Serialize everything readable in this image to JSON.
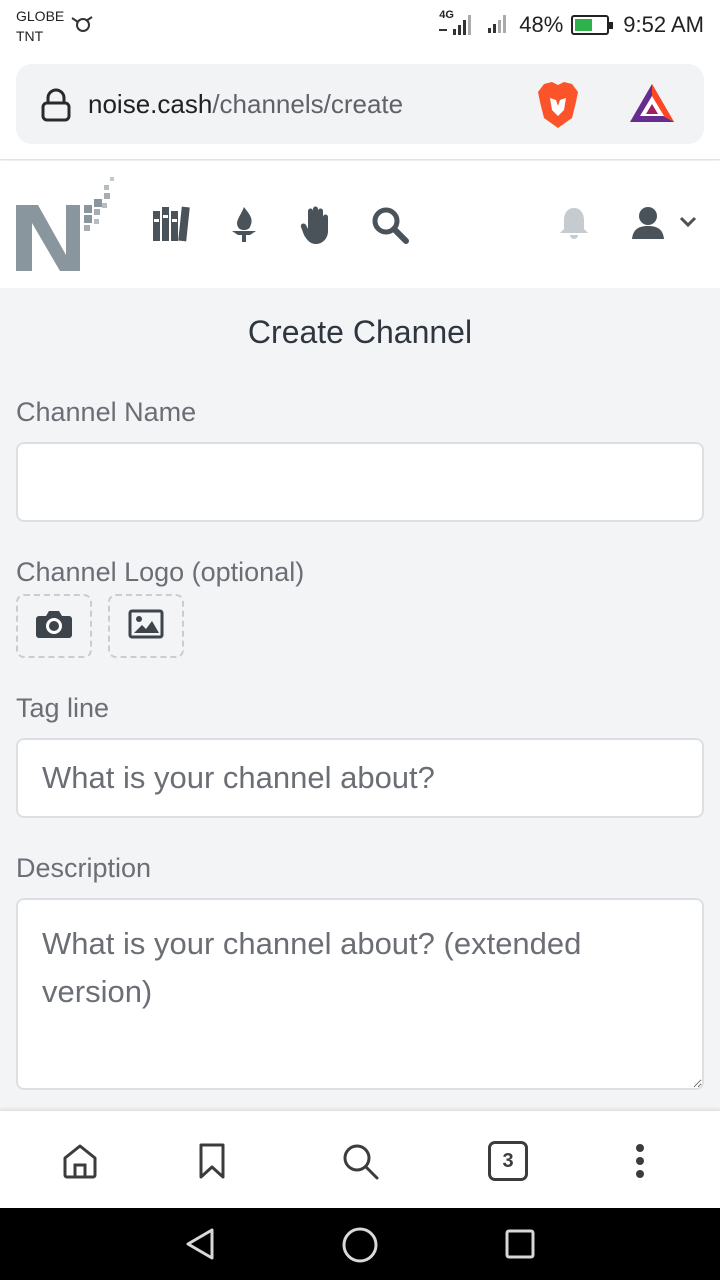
{
  "status_bar": {
    "carrier_line1": "GLOBE",
    "carrier_line2": "TNT",
    "network": "4G",
    "battery": "48%",
    "battery_level": 0.48,
    "time": "9:52 AM"
  },
  "browser": {
    "url_host": "noise.cash",
    "url_path": "/channels/create",
    "tab_count": "3"
  },
  "site_nav": {
    "icons": [
      "library-icon",
      "flame-icon",
      "raised-hand-icon",
      "search-icon"
    ],
    "right_icons": [
      "bell-icon",
      "user-icon",
      "chevron-down-icon"
    ]
  },
  "page": {
    "title": "Create Channel",
    "channel_name": {
      "label": "Channel Name",
      "value": "",
      "placeholder": ""
    },
    "channel_logo": {
      "label": "Channel Logo (optional)",
      "icons": [
        "camera-icon",
        "image-icon"
      ]
    },
    "tag_line": {
      "label": "Tag line",
      "value": "",
      "placeholder": "What is your channel about?"
    },
    "description": {
      "label": "Description",
      "value": "",
      "placeholder": "What is your channel about? (extended version)"
    }
  },
  "bottom_toolbar": {
    "icons": [
      "home-icon",
      "bookmark-icon",
      "search-icon",
      "tabs-icon",
      "more-vertical-icon"
    ]
  },
  "colors": {
    "page_bg": "#f3f4f6",
    "label": "#6b6f75",
    "title": "#2f3640",
    "logo_gray": "#8a969d",
    "icon_dark": "#4a525a",
    "brave_orange": "#fb542b"
  }
}
